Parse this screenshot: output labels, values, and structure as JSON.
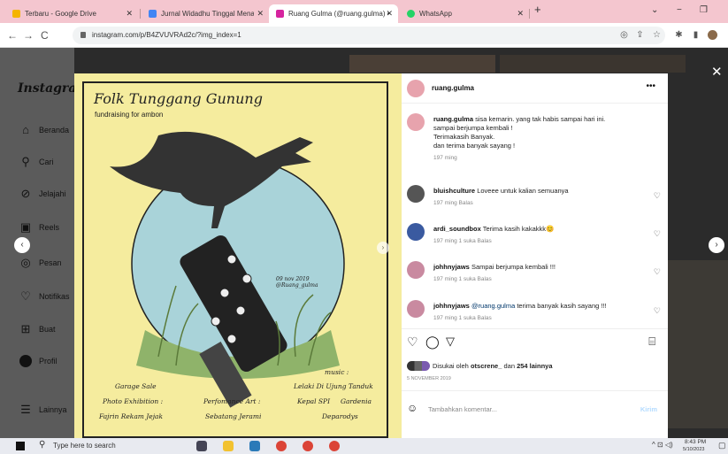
{
  "tabs": [
    {
      "label": "Terbaru - Google Drive",
      "color": "#f4b400"
    },
    {
      "label": "Jurnal Widadhu Tinggal Menang",
      "color": "#4285f4"
    },
    {
      "label": "Ruang Gulma (@ruang.gulma) •",
      "color": "#d6249f"
    },
    {
      "label": "WhatsApp",
      "color": "#25d366"
    }
  ],
  "url": "instagram.com/p/B4ZVUVRAd2c/?img_index=1",
  "sidebar": {
    "logo": "Instagram",
    "items": [
      {
        "label": "Beranda",
        "icon": "home-icon"
      },
      {
        "label": "Cari",
        "icon": "search-icon"
      },
      {
        "label": "Jelajahi",
        "icon": "compass-icon"
      },
      {
        "label": "Reels",
        "icon": "reels-icon"
      },
      {
        "label": "Pesan",
        "icon": "message-icon"
      },
      {
        "label": "Notifikas",
        "icon": "heart-icon"
      },
      {
        "label": "Buat",
        "icon": "plus-icon"
      },
      {
        "label": "Profil",
        "icon": "profile-icon"
      }
    ],
    "more": "Lainnya"
  },
  "poster": {
    "title": "Folk Tunggang Gunung",
    "subtitle": "fundraising for ambon",
    "date": "09 nov 2019\n@Ruang_gulma",
    "music_label": "music :",
    "col1": [
      "Garage Sale",
      "Photo Exhibition :",
      "Fajrin Rekam Jejak"
    ],
    "col2": [
      "Perfomance Art :",
      "Sebatang Jerami"
    ],
    "col3": [
      "Lelaki Di Ujung Tanduk",
      "Kepal SPI     Gardenia",
      "Deparodys"
    ]
  },
  "post": {
    "author": "ruang.gulma",
    "caption_user": "ruang.gulma",
    "caption": [
      "sisa kemarin. yang tak habis sampai hari ini.",
      "sampai berjumpa kembali !",
      "Terimakasih Banyak.",
      "dan terima banyak sayang !"
    ],
    "caption_time": "197 ming",
    "comments": [
      {
        "user": "bluishculture",
        "text": "Loveee untuk kalian semuanya",
        "meta": "197 ming   Balas"
      },
      {
        "user": "ardi_soundbox",
        "text": "Terima kasih kakakkk😊",
        "meta": "197 ming   1 suka   Balas"
      },
      {
        "user": "johhnyjaws",
        "text": "Sampai berjumpa kembali !!!",
        "meta": "197 ming   1 suka   Balas"
      },
      {
        "user": "johhnyjaws",
        "mention": "@ruang.gulma",
        "text": " terima banyak kasih sayang !!!",
        "meta": "197 ming   1 suka   Balas"
      }
    ],
    "likes_prefix": "Disukai oleh ",
    "likes_user": "otscrene_",
    "likes_mid": " dan ",
    "likes_count": "254 lainnya",
    "date": "5 NOVEMBER 2019",
    "comment_placeholder": "Tambahkan komentar...",
    "post_button": "Kirim"
  },
  "taskbar": {
    "search": "Type here to search",
    "time": "8:43 PM",
    "date": "5/10/2023"
  }
}
